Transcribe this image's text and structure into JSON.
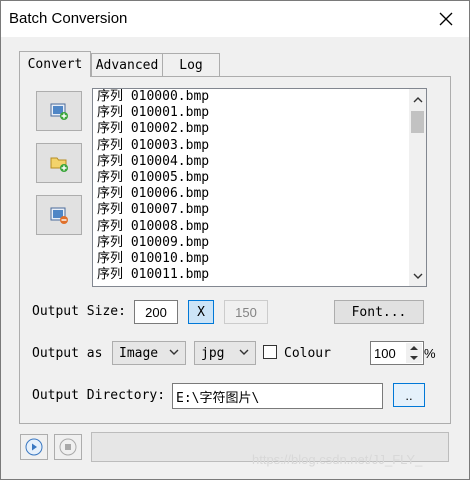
{
  "window": {
    "title": "Batch Conversion"
  },
  "tabs": [
    {
      "label": "Convert",
      "active": true
    },
    {
      "label": "Advanced",
      "active": false
    },
    {
      "label": "Log",
      "active": false
    }
  ],
  "toolbar": {
    "icons": [
      "add-files-icon",
      "add-folder-icon",
      "remove-file-icon"
    ]
  },
  "files": [
    "序列 010000.bmp",
    "序列 010001.bmp",
    "序列 010002.bmp",
    "序列 010003.bmp",
    "序列 010004.bmp",
    "序列 010005.bmp",
    "序列 010006.bmp",
    "序列 010007.bmp",
    "序列 010008.bmp",
    "序列 010009.bmp",
    "序列 010010.bmp",
    "序列 010011.bmp"
  ],
  "output_size": {
    "label": "Output Size:",
    "width": "200",
    "lock_label": "X",
    "height": "150",
    "font_button": "Font..."
  },
  "output_as": {
    "label": "Output as",
    "mode": "Image",
    "format": "jpg",
    "colour_label": "Colour",
    "colour_checked": false,
    "quality": "100",
    "quality_unit": "%"
  },
  "output_directory": {
    "label": "Output Directory:",
    "value": "E:\\字符图片\\",
    "browse_label": ".."
  },
  "watermark": "https://blog.csdn.net/JJ_FLY_",
  "colors": {
    "accent": "#0078d7",
    "selected_toggle": "#cce4f7"
  }
}
